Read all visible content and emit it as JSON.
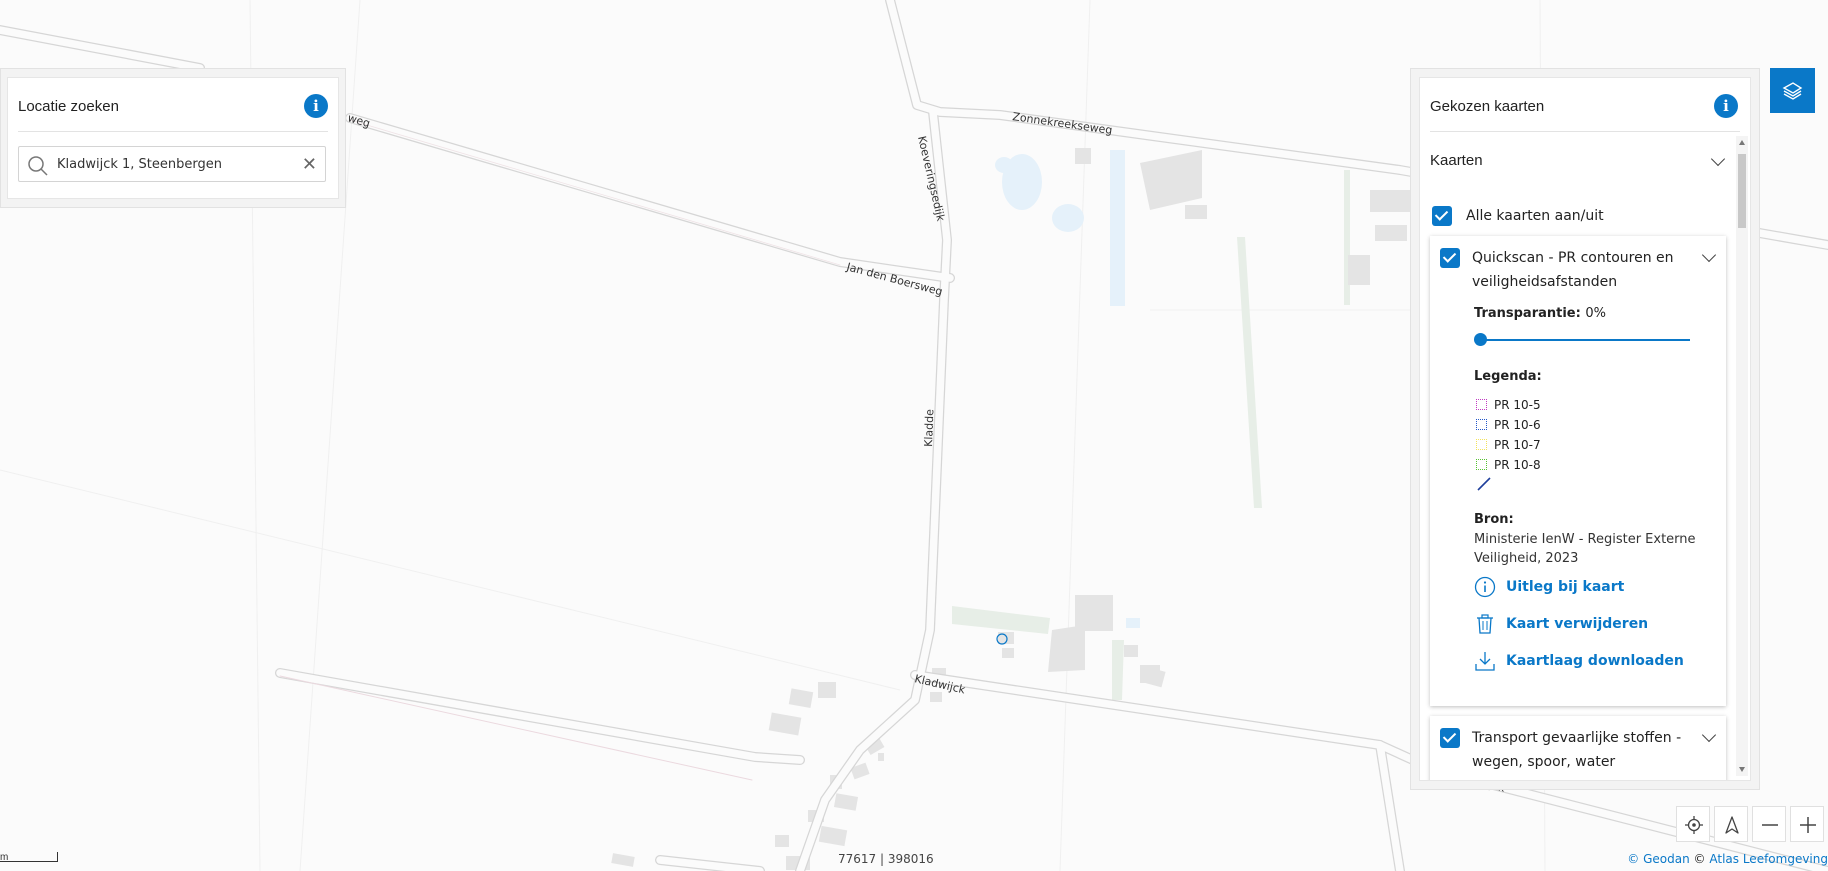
{
  "map": {
    "roads": {
      "zonnekreekseweg": "Zonnekreekseweg",
      "koeveringsedijk": "Koeveringsedijk",
      "jan_den_boersweg": "Jan den Boersweg",
      "kladde": "Kladde",
      "kladwijck": "Kladwijck",
      "weg_fragment": "weg",
      "ijck_fragment": "ijck"
    },
    "coords": "77617 | 398016",
    "scale_label": "m",
    "attribution": {
      "geodan": "© Geodan",
      "separator": "©",
      "atlas": "Atlas Leefomgeving"
    }
  },
  "search": {
    "title": "Locatie zoeken",
    "value": "Kladwijck 1, Steenbergen",
    "clear_icon": "✕",
    "info_icon": "i"
  },
  "maps_panel": {
    "title": "Gekozen kaarten",
    "info_icon": "i",
    "section": "Kaarten",
    "all_toggle": "Alle kaarten aan/uit",
    "layers": [
      {
        "title": "Quickscan - PR contouren en veiligheidsafstanden",
        "transparency_label": "Transparantie:",
        "transparency_value": "0%",
        "transparency_fraction": 0,
        "legend_label": "Legenda:",
        "legend": [
          {
            "name": "PR 10-5",
            "color": "#c13bc1"
          },
          {
            "name": "PR 10-6",
            "color": "#2457c9"
          },
          {
            "name": "PR 10-7",
            "color": "#f3e25a"
          },
          {
            "name": "PR 10-8",
            "color": "#58c232"
          }
        ],
        "source_label": "Bron:",
        "source": "Ministerie IenW - Register Externe Veiligheid, 2023",
        "actions": {
          "explain": "Uitleg bij kaart",
          "remove": "Kaart verwijderen",
          "download": "Kaartlaag downloaden"
        }
      },
      {
        "title": "Transport gevaarlijke stoffen - wegen, spoor, water"
      }
    ]
  },
  "colors": {
    "accent": "#0a78c8",
    "road_outline": "#d8d8d8",
    "building": "#e3e3e3",
    "water": "#e5f1fa",
    "vegetation": "#e8efe8"
  }
}
